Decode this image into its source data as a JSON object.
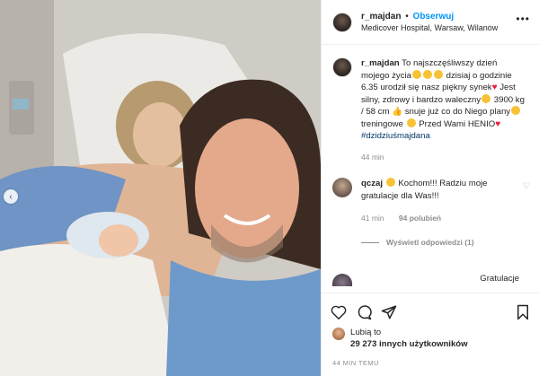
{
  "header": {
    "username": "r_majdan",
    "separator": "•",
    "follow_label": "Obserwuj",
    "location": "Medicover Hospital, Warsaw, Wilanow",
    "more_icon": "ellipsis-icon"
  },
  "caption": {
    "username": "r_majdan",
    "text_1": "To najszczęśliwszy dzień mojego życia",
    "text_2": "dzisiaj o godzinie 6.35 urodził się nasz piękny synek",
    "text_3": " Jest silny, zdrowy i bardzo waleczny",
    "text_4": " 3900 kg / 58 cm ",
    "text_5": " snuje już co do Niego plany",
    "text_6": " treningowe ",
    "text_7": " Przed Wami HENIO",
    "hashtag": "#dzidziuśmajdana",
    "time": "44 min"
  },
  "comments": [
    {
      "username": "qczaj",
      "text": "Kochom!!! Radziu moje gratulacje dla Was!!!",
      "time": "41 min",
      "likes": "94 polubień",
      "replies": "Wyświetl odpowiedzi (1)"
    }
  ],
  "cut_comment": {
    "text": "Gratulacje"
  },
  "likes": {
    "line1": "Lubią to",
    "count": "29 273",
    "line2_rest": " innych użytkowników"
  },
  "timeago": "44 MIN TEMU",
  "colors": {
    "link_blue": "#0095f6",
    "hashtag": "#00376b",
    "heart_red": "#ed1c3b",
    "meta_gray": "#8e8e8e"
  }
}
